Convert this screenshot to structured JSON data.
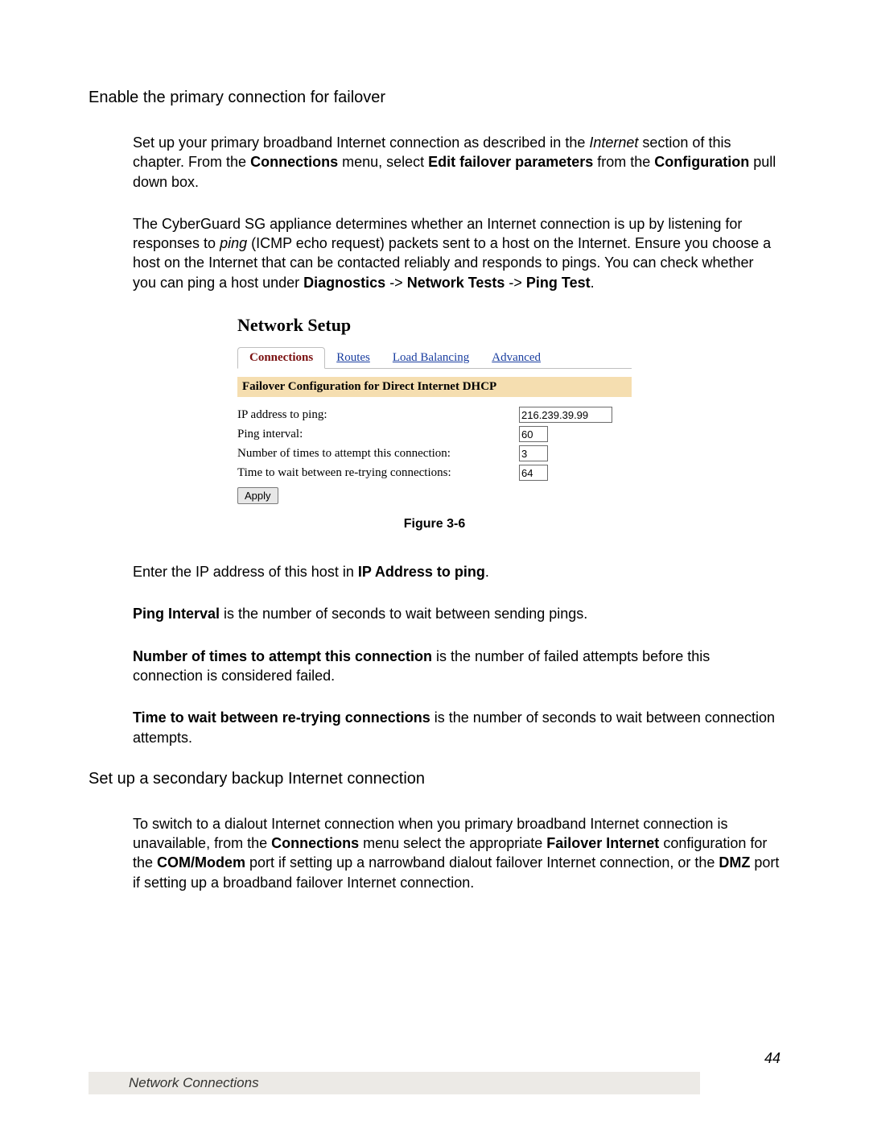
{
  "heading1": "Enable the primary connection for failover",
  "para1_a": "Set up your primary broadband Internet connection as described in the ",
  "para1_b_italic": "Internet",
  "para1_c": " section of this chapter.  From the ",
  "para1_d_bold": "Connections",
  "para1_e": " menu, select ",
  "para1_f_bold": "Edit failover parameters",
  "para1_g": " from the ",
  "para1_h_bold": "Configuration",
  "para1_i": " pull down box.",
  "para2_a": "The CyberGuard SG appliance determines whether an Internet connection is up by listening for responses to ",
  "para2_b_italic": "ping",
  "para2_c": " (ICMP echo request) packets sent to a host on the Internet.  Ensure you choose a host on the Internet that can be contacted reliably and responds to pings.  You can check whether you can ping a host under ",
  "para2_d_bold": "Diagnostics",
  "para2_e": " -> ",
  "para2_f_bold": "Network Tests",
  "para2_g": " -> ",
  "para2_h_bold": "Ping Test",
  "para2_i": ".",
  "figure": {
    "title": "Network Setup",
    "tabs": {
      "connections": "Connections",
      "routes": "Routes",
      "load_balancing": "Load Balancing",
      "advanced": "Advanced"
    },
    "section_header": "Failover Configuration for Direct Internet DHCP",
    "fields": {
      "ip_label": "IP address to ping:",
      "ip_value": "216.239.39.99",
      "interval_label": "Ping interval:",
      "interval_value": "60",
      "attempts_label": "Number of times to attempt this connection:",
      "attempts_value": "3",
      "wait_label": "Time to wait between re-trying connections:",
      "wait_value": "64"
    },
    "apply": "Apply",
    "caption": "Figure 3-6"
  },
  "para3_a": "Enter the IP address of this host in ",
  "para3_b_bold": "IP Address to ping",
  "para3_c": ".",
  "para4_a_bold": "Ping Interval",
  "para4_b": " is the number of seconds to wait between sending pings.",
  "para5_a_bold": "Number of times to attempt this connection",
  "para5_b": " is the number of failed attempts before this connection is considered failed.",
  "para6_a_bold": "Time to wait between re-trying connections",
  "para6_b": " is the number of seconds to wait between connection attempts.",
  "heading2": "Set up a secondary backup Internet connection",
  "para7_a": "To switch to a dialout Internet connection when you primary broadband Internet connection is unavailable, from the ",
  "para7_b_bold": "Connections",
  "para7_c": " menu select the appropriate ",
  "para7_d_bold": "Failover Internet",
  "para7_e": " configuration for the ",
  "para7_f_bold": "COM/Modem",
  "para7_g": " port if setting up a narrowband dialout failover Internet connection, or the ",
  "para7_h_bold": "DMZ",
  "para7_i": " port if setting up a broadband failover Internet connection.",
  "footer": {
    "page": "44",
    "title": "Network Connections"
  }
}
